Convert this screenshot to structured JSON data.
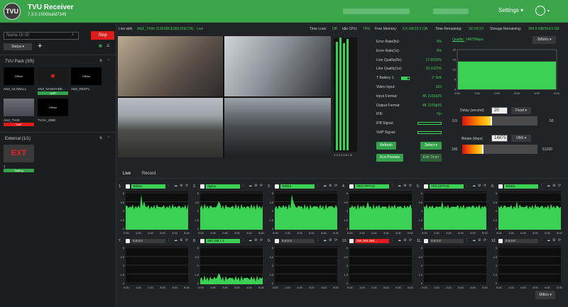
{
  "app": {
    "logo": "TVU",
    "title": "TVU Receiver",
    "version": "7.3.0.1000build7349"
  },
  "header": {
    "settings_label": "Settings ▾"
  },
  "sidebar": {
    "search_placeholder": "Name Or ID",
    "stop_label": "Stop",
    "status_label": "Status ▾",
    "add_label": "+",
    "pack_title": "TVU Pack (3/5)",
    "external_title": "External (1/1)",
    "devices": [
      {
        "name": "ANZ_GLOBAL1",
        "label": "Offline",
        "tag": ""
      },
      {
        "name": "ANZ_NANOVIDE...",
        "label": "",
        "tag": "VoIP"
      },
      {
        "name": "ANZ_RENT1",
        "label": "Offline",
        "tag": ""
      },
      {
        "name": "ANZ_TX4K",
        "label": "",
        "tag": "VoIP"
      },
      {
        "name": "TVUA_408D",
        "label": "Offline",
        "tag": ""
      }
    ],
    "ext": {
      "name": "1",
      "label": "EXT",
      "tag": "Setting"
    }
  },
  "live": {
    "live_with_label": "Live with",
    "live_with_value": "ANZ_TX4K (C26SBCE0B1266CTA) - Live",
    "time_lock_label": "Time Lock:",
    "time_lock_value": "Off",
    "idle_cpu_label": "Idle CPU:",
    "idle_cpu_value": "74%",
    "free_mem_label": "Free Memory:",
    "free_mem_value": "6.6 GB/15.2 GB",
    "time_rem_label": "Time Remaining:",
    "time_rem_value": "2d 9:8:22",
    "storage_label": "Storage Remaining:",
    "storage_value": "364.9 GB/364.9 GB"
  },
  "stats": [
    {
      "label": "Error Rate(8s):",
      "value": "0%"
    },
    {
      "label": "Error Rate(1s):",
      "value": "0%"
    },
    {
      "label": "Line Quality(8s):",
      "value": "17.6033%"
    },
    {
      "label": "Line Quality(1s):",
      "value": "20.1022%"
    },
    {
      "label": "T Battery 1:",
      "value": "2:  N/A"
    },
    {
      "label": "Video Input:",
      "value": "SDI"
    },
    {
      "label": "Input Format:",
      "value": "4K 2160p25"
    },
    {
      "label": "Output Format:",
      "value": "4K 2160p25"
    },
    {
      "label": "IFB:",
      "value": "On"
    },
    {
      "label": "IFB Signal:",
      "value": ""
    },
    {
      "label": "VoIP Signal:",
      "value": ""
    }
  ],
  "buttons": {
    "refresh": "Refresh",
    "select": "Select ▾",
    "eco": "Eco-Preview",
    "edit": "Edit Timer"
  },
  "quality": {
    "label": "Quality:",
    "value": "14875kbps",
    "select": "2Mbit/s ▾",
    "chart_data": {
      "type": "area",
      "x": [
        "0:00",
        "1:00",
        "2:00",
        "3:00",
        "4:00",
        "5:00"
      ],
      "ylim": [
        0,
        20
      ],
      "yticks": [
        0,
        5,
        10,
        15,
        20
      ],
      "values": [
        14,
        14,
        14,
        14,
        14,
        14
      ]
    }
  },
  "delay": {
    "label": "Delay (second)",
    "value": "20",
    "mode": "Fixed ▾",
    "min": "0.5",
    "max": "50"
  },
  "bitrate": {
    "label": "Bitrate (kbps)",
    "value": "14875",
    "mode": "VBR ▾",
    "min": "100",
    "max": "51200"
  },
  "tabs": [
    "Live",
    "Record"
  ],
  "channels": [
    {
      "n": "1.",
      "name": "Telstra",
      "bad": false
    },
    {
      "n": "2.",
      "name": "Optus",
      "bad": false
    },
    {
      "n": "3.",
      "name": "Telstra",
      "bad": false
    },
    {
      "n": "4.",
      "name": "YES OPTUS",
      "bad": false
    },
    {
      "n": "5.",
      "name": "YES OPTUS",
      "bad": false
    },
    {
      "n": "6.",
      "name": "Telstra",
      "bad": false
    },
    {
      "n": "7.",
      "name": "0.0.0.0",
      "bad": false,
      "off": true
    },
    {
      "n": "8.",
      "name": "192.168.1.4",
      "bad": false
    },
    {
      "n": "9.",
      "name": "0.0.0.0",
      "bad": false,
      "off": true
    },
    {
      "n": "10.",
      "name": "255.255.255....",
      "bad": true,
      "off": true
    },
    {
      "n": "11.",
      "name": "0.0.0.0",
      "bad": false,
      "off": true
    },
    {
      "n": "12.",
      "name": "0.0.0.0",
      "bad": false,
      "off": true
    }
  ],
  "chart_axis": {
    "x": [
      "0:00",
      "1:00",
      "2:00",
      "3:00",
      "4:00",
      "5:00"
    ],
    "y": [
      "0",
      "1.5",
      "3",
      "4.5",
      "6"
    ]
  },
  "scale_btn": "6Mb/s ▾",
  "meter_label": "1 2 3 4 5 6 7 8"
}
